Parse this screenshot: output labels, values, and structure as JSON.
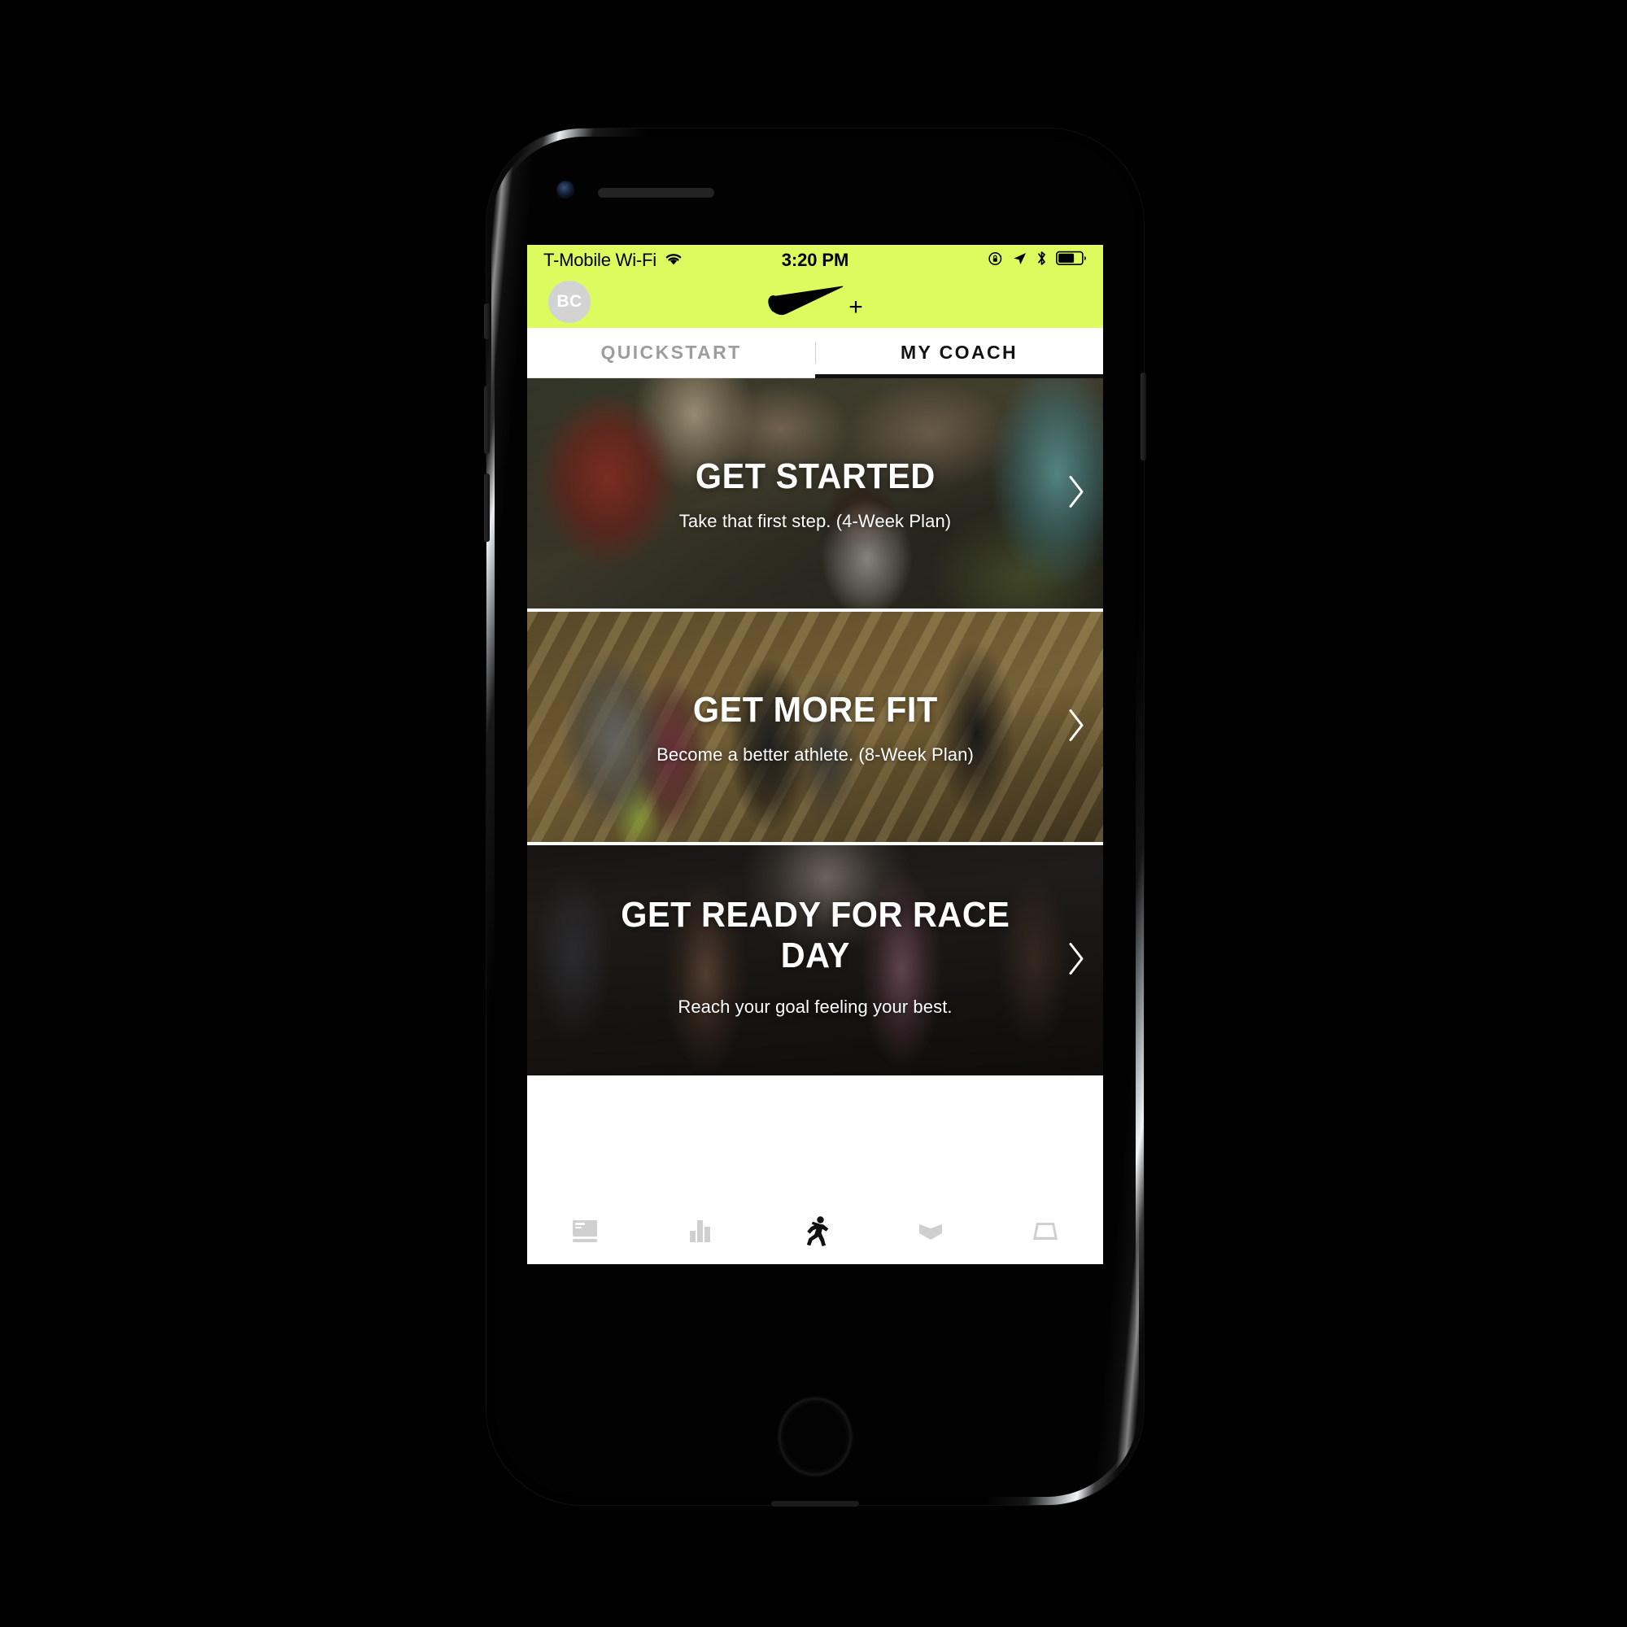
{
  "theme": {
    "brand_color": "#ddfb5e",
    "active_tab_color": "#121212",
    "inactive_tab_color": "#9d9d9d"
  },
  "status_bar": {
    "carrier": "T-Mobile Wi-Fi",
    "wifi_icon": "wifi-icon",
    "time": "3:20 PM",
    "icons": [
      {
        "name": "rotation-lock-icon"
      },
      {
        "name": "location-arrow-icon"
      },
      {
        "name": "bluetooth-icon"
      },
      {
        "name": "battery-icon",
        "level_percent": 62
      }
    ]
  },
  "header": {
    "avatar_initials": "BC",
    "logo_name": "nike-swoosh-logo",
    "logo_plus": "+"
  },
  "tabs": [
    {
      "label": "QUICKSTART",
      "active": false
    },
    {
      "label": "MY COACH",
      "active": true
    }
  ],
  "cards": [
    {
      "title": "GET STARTED",
      "subtitle": "Take that first step. (4-Week Plan)",
      "chevron": "chevron-right-icon",
      "photo": "group-high-five-photo"
    },
    {
      "title": "GET MORE FIT",
      "subtitle": "Become a better athlete. (8-Week Plan)",
      "chevron": "chevron-right-icon",
      "photo": "runners-on-bridge-photo"
    },
    {
      "title": "GET READY FOR RACE DAY",
      "subtitle": "Reach your goal feeling your best.",
      "chevron": "chevron-right-icon",
      "photo": "night-runners-photo"
    }
  ],
  "bottom_nav": [
    {
      "name": "feed-icon",
      "active": false
    },
    {
      "name": "activity-chart-icon",
      "active": false
    },
    {
      "name": "run-icon",
      "active": true
    },
    {
      "name": "shop-icon",
      "active": false
    },
    {
      "name": "inbox-icon",
      "active": false
    }
  ]
}
